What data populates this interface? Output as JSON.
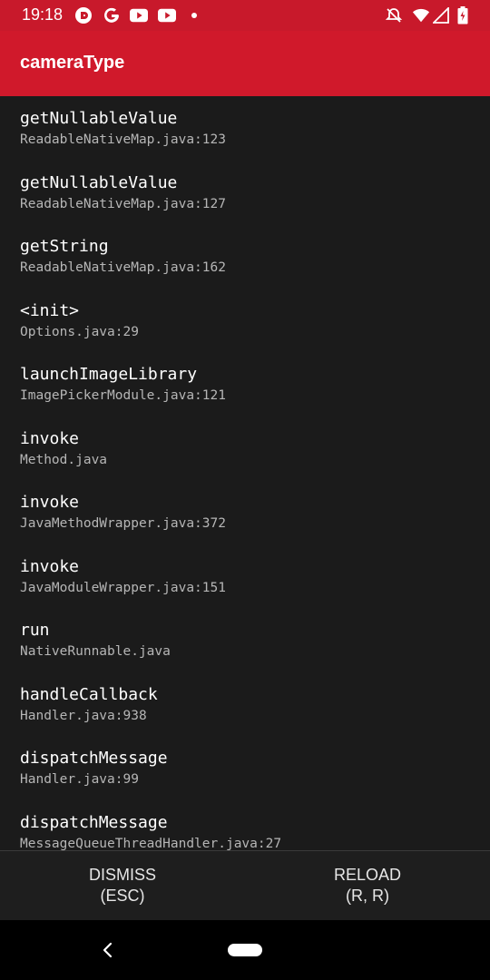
{
  "status_bar": {
    "time": "19:18",
    "icons": [
      "pocket-casts-icon",
      "google-icon",
      "youtube-icon",
      "youtube-icon",
      "notification-dot-icon",
      "do-not-disturb-icon",
      "wifi-icon",
      "signal-icon",
      "battery-icon"
    ]
  },
  "header": {
    "title": "cameraType"
  },
  "stack_frames": [
    {
      "method": "getNullableValue",
      "file": "ReadableNativeMap.java:123"
    },
    {
      "method": "getNullableValue",
      "file": "ReadableNativeMap.java:127"
    },
    {
      "method": "getString",
      "file": "ReadableNativeMap.java:162"
    },
    {
      "method": "<init>",
      "file": "Options.java:29"
    },
    {
      "method": "launchImageLibrary",
      "file": "ImagePickerModule.java:121"
    },
    {
      "method": "invoke",
      "file": "Method.java"
    },
    {
      "method": "invoke",
      "file": "JavaMethodWrapper.java:372"
    },
    {
      "method": "invoke",
      "file": "JavaModuleWrapper.java:151"
    },
    {
      "method": "run",
      "file": "NativeRunnable.java"
    },
    {
      "method": "handleCallback",
      "file": "Handler.java:938"
    },
    {
      "method": "dispatchMessage",
      "file": "Handler.java:99"
    },
    {
      "method": "dispatchMessage",
      "file": "MessageQueueThreadHandler.java:27"
    }
  ],
  "buttons": {
    "dismiss_label": "DISMISS",
    "dismiss_shortcut": "(ESC)",
    "reload_label": "RELOAD",
    "reload_shortcut": "(R, R)"
  },
  "colors": {
    "accent": "#d0192b",
    "background": "#1b1b1b"
  }
}
